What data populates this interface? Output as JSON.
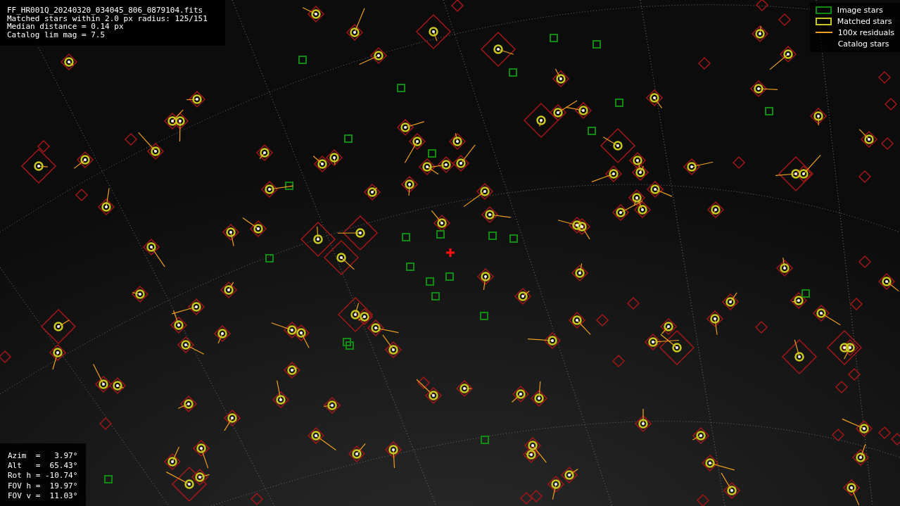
{
  "info": {
    "lines": [
      "FF_HR001Q_20240320_034045_806_0879104.fits",
      "Matched stars within 2.0 px radius: 125/151",
      "Median distance = 0.14 px",
      "Catalog lim mag = 7.5"
    ]
  },
  "legend": [
    {
      "label": "Image stars",
      "kind": "box",
      "color": "#118a11"
    },
    {
      "label": "Matched stars",
      "kind": "box",
      "color": "#c8c820"
    },
    {
      "label": "100x residuals",
      "kind": "line",
      "color": "#f0a020"
    },
    {
      "label": "Catalog stars",
      "kind": "none"
    }
  ],
  "pointing": {
    "lines": [
      "Azim  =   3.97°",
      "Alt   =  65.43°",
      "Rot h = -10.74°",
      "FOV h =  19.97°",
      "FOV v =  11.03°"
    ]
  }
}
